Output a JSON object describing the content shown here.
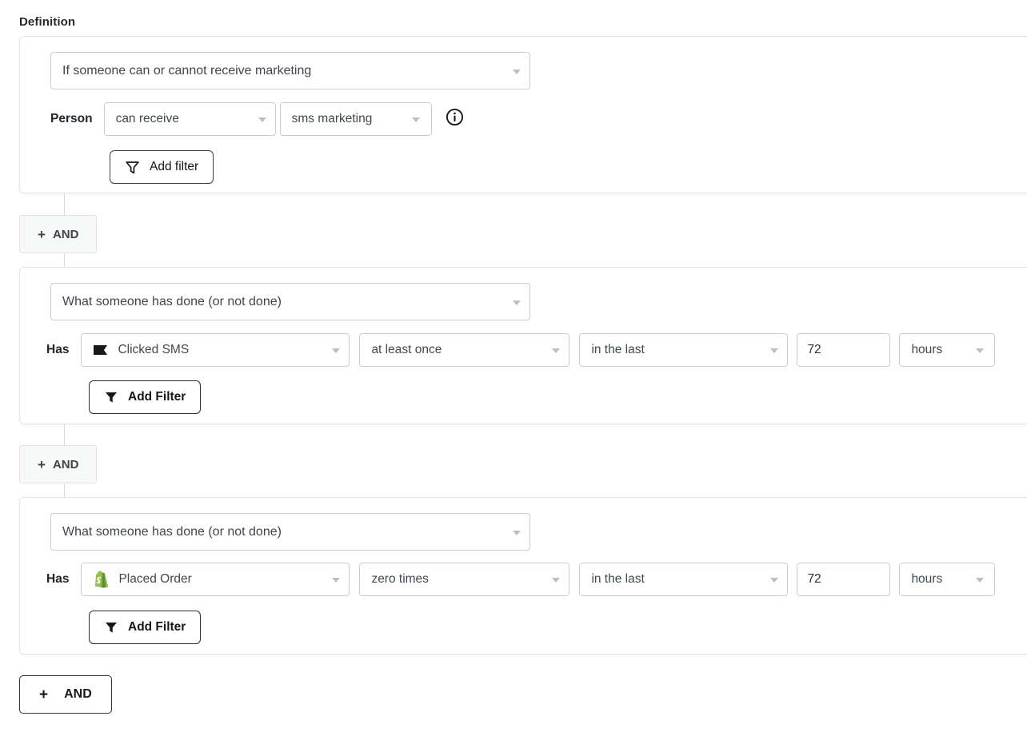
{
  "section": {
    "title": "Definition"
  },
  "blocks": [
    {
      "id": "block-can-receive-marketing",
      "type_select": {
        "label": "If someone can or cannot receive marketing",
        "caret": "chevron-down-icon"
      },
      "row_label": "Person",
      "controls": [
        {
          "name": "consent-operator-select",
          "label": "can receive",
          "kind": "select"
        },
        {
          "name": "consent-channel-select",
          "label": "sms marketing",
          "kind": "select"
        }
      ],
      "info_icon": "info-icon",
      "add_filter": {
        "label": "Add filter",
        "icon": "funnel-outline-icon",
        "style": "regular"
      }
    },
    {
      "id": "block-clicked-sms",
      "type_select": {
        "label": "What someone has done (or not done)",
        "caret": "chevron-down-icon"
      },
      "row_label": "Has",
      "event": {
        "name": "metric-select",
        "label": "Clicked SMS",
        "icon": "sms-flag-icon",
        "icon_color": "#15181b"
      },
      "controls": [
        {
          "name": "frequency-select",
          "label": "at least once",
          "kind": "select"
        },
        {
          "name": "timeframe-select",
          "label": "in the last",
          "kind": "select"
        },
        {
          "name": "duration-input",
          "label": "72",
          "kind": "input"
        },
        {
          "name": "duration-unit-select",
          "label": "hours",
          "kind": "select"
        }
      ],
      "add_filter": {
        "label": "Add Filter",
        "icon": "funnel-solid-icon",
        "style": "bold"
      }
    },
    {
      "id": "block-placed-order",
      "type_select": {
        "label": "What someone has done (or not done)",
        "caret": "chevron-down-icon"
      },
      "row_label": "Has",
      "event": {
        "name": "metric-select",
        "label": "Placed Order",
        "icon": "shopify-icon",
        "icon_color": "#95BF47"
      },
      "controls": [
        {
          "name": "frequency-select",
          "label": "zero times",
          "kind": "select"
        },
        {
          "name": "timeframe-select",
          "label": "in the last",
          "kind": "select"
        },
        {
          "name": "duration-input",
          "label": "72",
          "kind": "input"
        },
        {
          "name": "duration-unit-select",
          "label": "hours",
          "kind": "select"
        }
      ],
      "add_filter": {
        "label": "Add Filter",
        "icon": "funnel-solid-icon",
        "style": "bold"
      }
    }
  ],
  "connectors": {
    "and_chip_1": {
      "label": "AND",
      "plus": "+"
    },
    "and_chip_2": {
      "label": "AND",
      "plus": "+"
    }
  },
  "footer": {
    "and_button": {
      "label": "AND",
      "plus": "+"
    }
  },
  "colors": {
    "card_border": "#e4e7ea",
    "control_border": "#c9ced3",
    "text": "#1f2326",
    "caret": "#b9bfc5",
    "shopify_green": "#95BF47",
    "chip_bg": "#f7f8f8"
  }
}
